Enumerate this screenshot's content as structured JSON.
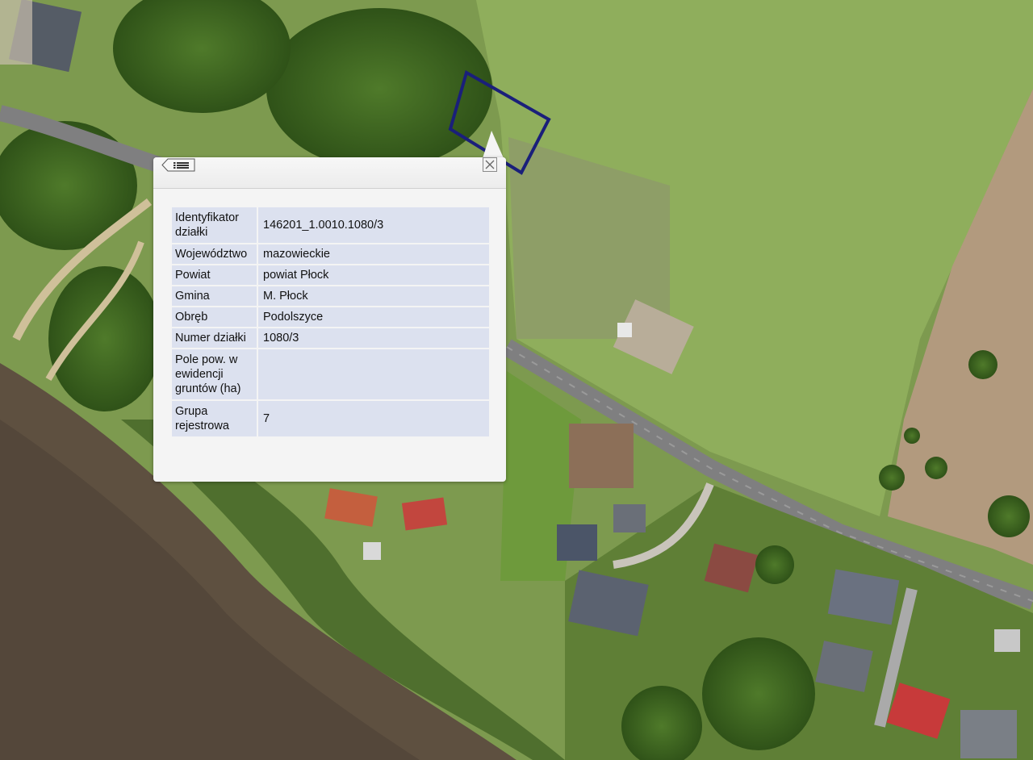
{
  "map": {
    "basemap": "aerial-orthophoto",
    "parcel_outline_color": "#1a1f7a"
  },
  "popup": {
    "list_icon": "list-icon",
    "close_icon": "close-icon",
    "rows": [
      {
        "key": "Identyfikator działki",
        "value": "146201_1.0010.1080/3"
      },
      {
        "key": "Województwo",
        "value": "mazowieckie"
      },
      {
        "key": "Powiat",
        "value": "powiat Płock"
      },
      {
        "key": "Gmina",
        "value": "M. Płock"
      },
      {
        "key": "Obręb",
        "value": "Podolszyce"
      },
      {
        "key": "Numer działki",
        "value": "1080/3"
      },
      {
        "key": "Pole pow. w ewidencji gruntów (ha)",
        "value": ""
      },
      {
        "key": "Grupa rejestrowa",
        "value": "7"
      }
    ]
  }
}
